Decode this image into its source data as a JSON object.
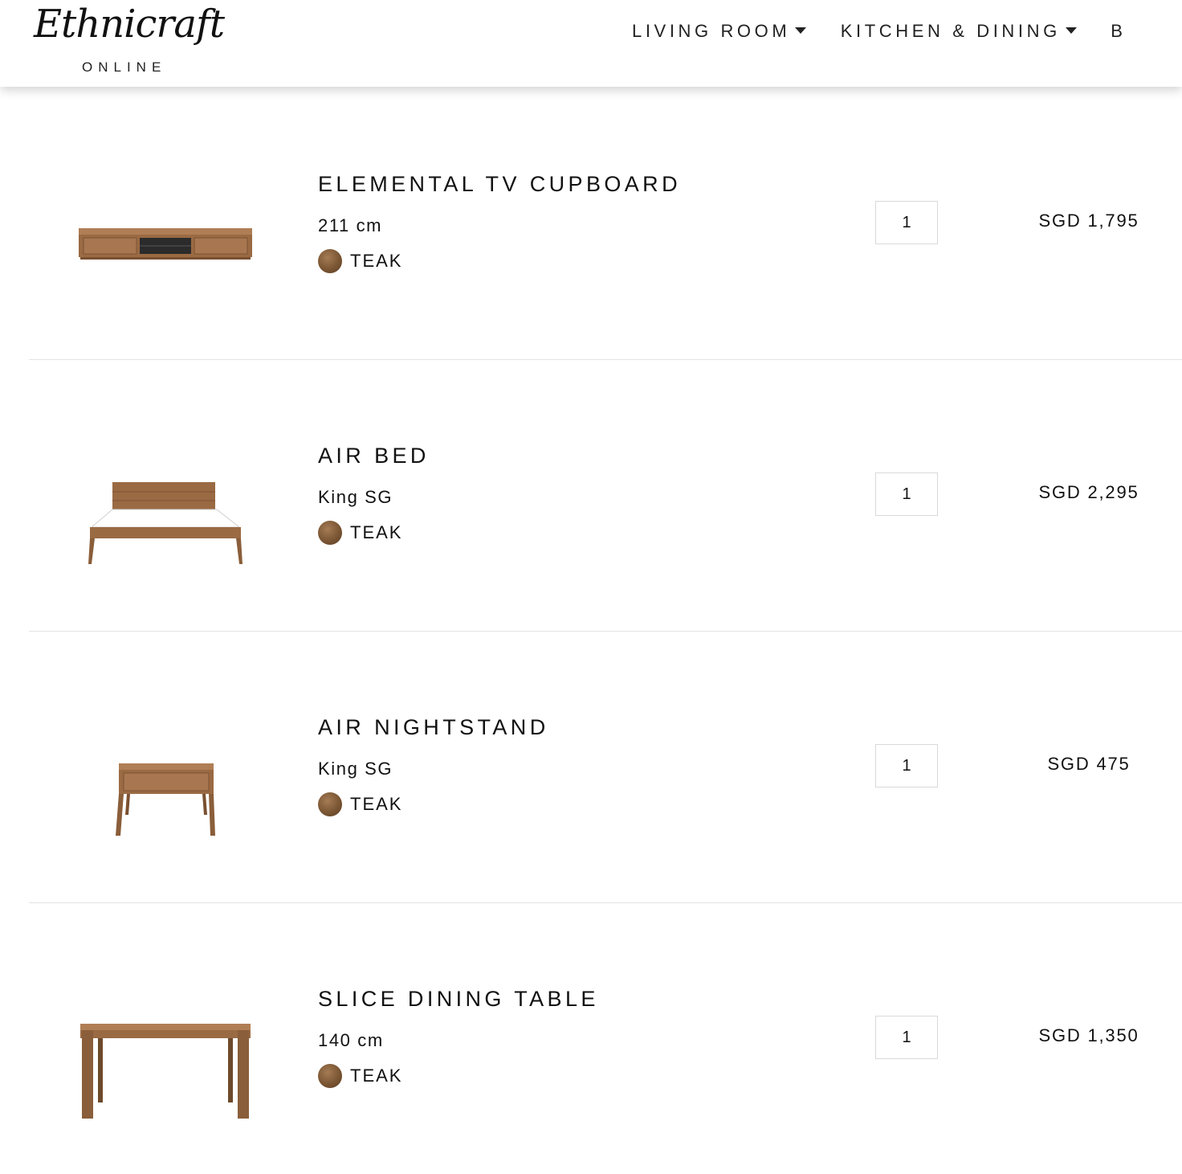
{
  "header": {
    "logo_script": "Ethnicraft",
    "logo_sub": "ONLINE",
    "nav": [
      {
        "label": "LIVING ROOM"
      },
      {
        "label": "KITCHEN & DINING"
      },
      {
        "label": "B"
      }
    ]
  },
  "cart": {
    "items": [
      {
        "name": "ELEMENTAL TV CUPBOARD",
        "size": "211 cm",
        "finish": "TEAK",
        "qty": "1",
        "price": "SGD 1,795"
      },
      {
        "name": "AIR BED",
        "size": "King SG",
        "finish": "TEAK",
        "qty": "1",
        "price": "SGD 2,295"
      },
      {
        "name": "AIR NIGHTSTAND",
        "size": "King SG",
        "finish": "TEAK",
        "qty": "1",
        "price": "SGD 475"
      },
      {
        "name": "SLICE DINING TABLE",
        "size": "140 cm",
        "finish": "TEAK",
        "qty": "1",
        "price": "SGD 1,350"
      }
    ]
  },
  "colors": {
    "teak_swatch": "#7b5634",
    "wood": "#9a6a43",
    "divider": "#e3e3e3"
  }
}
